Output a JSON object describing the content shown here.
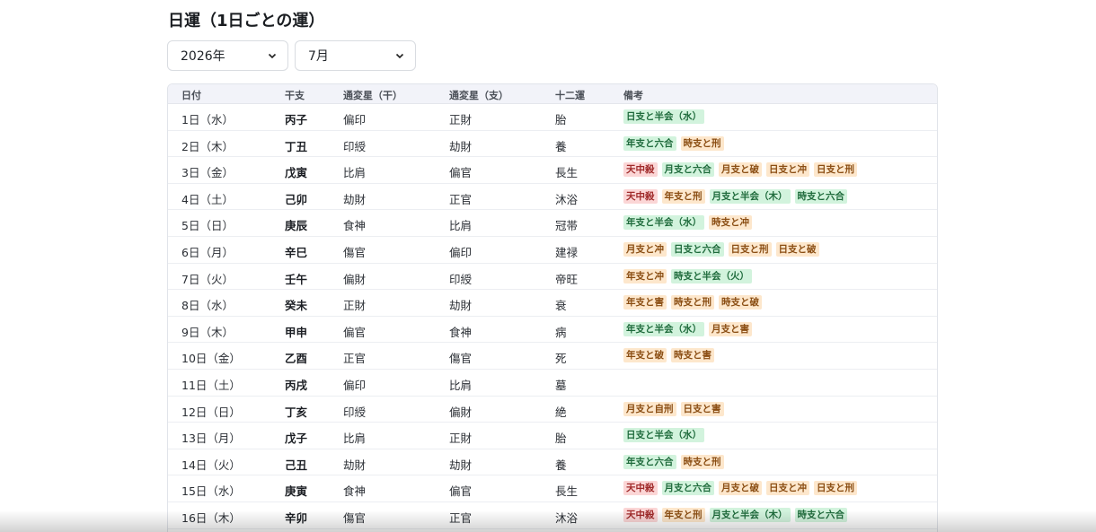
{
  "page_title": "日運（1日ごとの運）",
  "selects": {
    "year": "2026年",
    "month": "7月"
  },
  "headers": [
    "日付",
    "干支",
    "通変星（干）",
    "通変星（支）",
    "十二運",
    "備考"
  ],
  "colors": {
    "green_tag": "#d2f3dd",
    "orange_tag": "#fde7cc",
    "red_tag": "#fbd6d6",
    "header_bg": "#f2f3f9"
  },
  "rows": [
    {
      "date": "1日（水）",
      "gz": "丙子",
      "s1": "偏印",
      "s2": "正財",
      "twelve": "胎",
      "notes": [
        {
          "t": "日支と半会（水）",
          "c": "g"
        }
      ]
    },
    {
      "date": "2日（木）",
      "gz": "丁丑",
      "s1": "印綬",
      "s2": "劫財",
      "twelve": "養",
      "notes": [
        {
          "t": "年支と六合",
          "c": "g"
        },
        {
          "t": "時支と刑",
          "c": "o"
        }
      ]
    },
    {
      "date": "3日（金）",
      "gz": "戊寅",
      "s1": "比肩",
      "s2": "偏官",
      "twelve": "長生",
      "notes": [
        {
          "t": "天中殺",
          "c": "r"
        },
        {
          "t": "月支と六合",
          "c": "g"
        },
        {
          "t": "月支と破",
          "c": "o"
        },
        {
          "t": "日支と冲",
          "c": "o"
        },
        {
          "t": "日支と刑",
          "c": "o"
        }
      ]
    },
    {
      "date": "4日（土）",
      "gz": "己卯",
      "s1": "劫財",
      "s2": "正官",
      "twelve": "沐浴",
      "notes": [
        {
          "t": "天中殺",
          "c": "r"
        },
        {
          "t": "年支と刑",
          "c": "o"
        },
        {
          "t": "月支と半会（木）",
          "c": "g"
        },
        {
          "t": "時支と六合",
          "c": "g"
        }
      ]
    },
    {
      "date": "5日（日）",
      "gz": "庚辰",
      "s1": "食神",
      "s2": "比肩",
      "twelve": "冠帯",
      "notes": [
        {
          "t": "年支と半会（水）",
          "c": "g"
        },
        {
          "t": "時支と冲",
          "c": "o"
        }
      ]
    },
    {
      "date": "6日（月）",
      "gz": "辛巳",
      "s1": "傷官",
      "s2": "偏印",
      "twelve": "建禄",
      "notes": [
        {
          "t": "月支と冲",
          "c": "o"
        },
        {
          "t": "日支と六合",
          "c": "g"
        },
        {
          "t": "日支と刑",
          "c": "o"
        },
        {
          "t": "日支と破",
          "c": "o"
        }
      ]
    },
    {
      "date": "7日（火）",
      "gz": "壬午",
      "s1": "偏財",
      "s2": "印綬",
      "twelve": "帝旺",
      "notes": [
        {
          "t": "年支と冲",
          "c": "o"
        },
        {
          "t": "時支と半会（火）",
          "c": "g"
        }
      ]
    },
    {
      "date": "8日（水）",
      "gz": "癸未",
      "s1": "正財",
      "s2": "劫財",
      "twelve": "衰",
      "notes": [
        {
          "t": "年支と害",
          "c": "o"
        },
        {
          "t": "時支と刑",
          "c": "o"
        },
        {
          "t": "時支と破",
          "c": "o"
        }
      ]
    },
    {
      "date": "9日（木）",
      "gz": "甲申",
      "s1": "偏官",
      "s2": "食神",
      "twelve": "病",
      "notes": [
        {
          "t": "年支と半会（水）",
          "c": "g"
        },
        {
          "t": "月支と害",
          "c": "o"
        }
      ]
    },
    {
      "date": "10日（金）",
      "gz": "乙酉",
      "s1": "正官",
      "s2": "傷官",
      "twelve": "死",
      "notes": [
        {
          "t": "年支と破",
          "c": "o"
        },
        {
          "t": "時支と害",
          "c": "o"
        }
      ]
    },
    {
      "date": "11日（土）",
      "gz": "丙戌",
      "s1": "偏印",
      "s2": "比肩",
      "twelve": "墓",
      "notes": []
    },
    {
      "date": "12日（日）",
      "gz": "丁亥",
      "s1": "印綬",
      "s2": "偏財",
      "twelve": "絶",
      "notes": [
        {
          "t": "月支と自刑",
          "c": "o"
        },
        {
          "t": "日支と害",
          "c": "o"
        }
      ]
    },
    {
      "date": "13日（月）",
      "gz": "戊子",
      "s1": "比肩",
      "s2": "正財",
      "twelve": "胎",
      "notes": [
        {
          "t": "日支と半会（水）",
          "c": "g"
        }
      ]
    },
    {
      "date": "14日（火）",
      "gz": "己丑",
      "s1": "劫財",
      "s2": "劫財",
      "twelve": "養",
      "notes": [
        {
          "t": "年支と六合",
          "c": "g"
        },
        {
          "t": "時支と刑",
          "c": "o"
        }
      ]
    },
    {
      "date": "15日（水）",
      "gz": "庚寅",
      "s1": "食神",
      "s2": "偏官",
      "twelve": "長生",
      "notes": [
        {
          "t": "天中殺",
          "c": "r"
        },
        {
          "t": "月支と六合",
          "c": "g"
        },
        {
          "t": "月支と破",
          "c": "o"
        },
        {
          "t": "日支と冲",
          "c": "o"
        },
        {
          "t": "日支と刑",
          "c": "o"
        }
      ]
    },
    {
      "date": "16日（木）",
      "gz": "辛卯",
      "s1": "傷官",
      "s2": "正官",
      "twelve": "沐浴",
      "notes": [
        {
          "t": "天中殺",
          "c": "r"
        },
        {
          "t": "年支と刑",
          "c": "o"
        },
        {
          "t": "月支と半会（木）",
          "c": "g"
        },
        {
          "t": "時支と六合",
          "c": "g"
        }
      ]
    }
  ]
}
